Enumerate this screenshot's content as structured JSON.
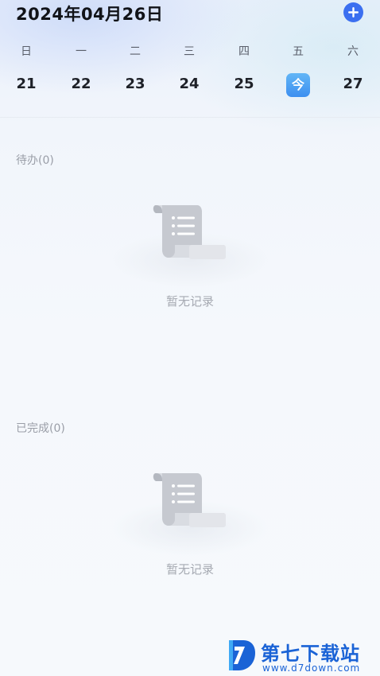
{
  "header": {
    "date_title": "2024年04月26日",
    "add_icon": "plus-icon",
    "accent_color": "#3b6ff0"
  },
  "week": {
    "labels": [
      "日",
      "一",
      "二",
      "三",
      "四",
      "五",
      "六"
    ],
    "days": [
      "21",
      "22",
      "23",
      "24",
      "25",
      "今",
      "27"
    ],
    "today_index": 5
  },
  "sections": {
    "todo": {
      "title": "待办(0)",
      "empty_text": "暂无记录"
    },
    "done": {
      "title": "已完成(0)",
      "empty_text": "暂无记录"
    }
  },
  "watermark": {
    "brand": "第七下载站",
    "url": "www.d7down.com",
    "color": "#1a63d6"
  }
}
